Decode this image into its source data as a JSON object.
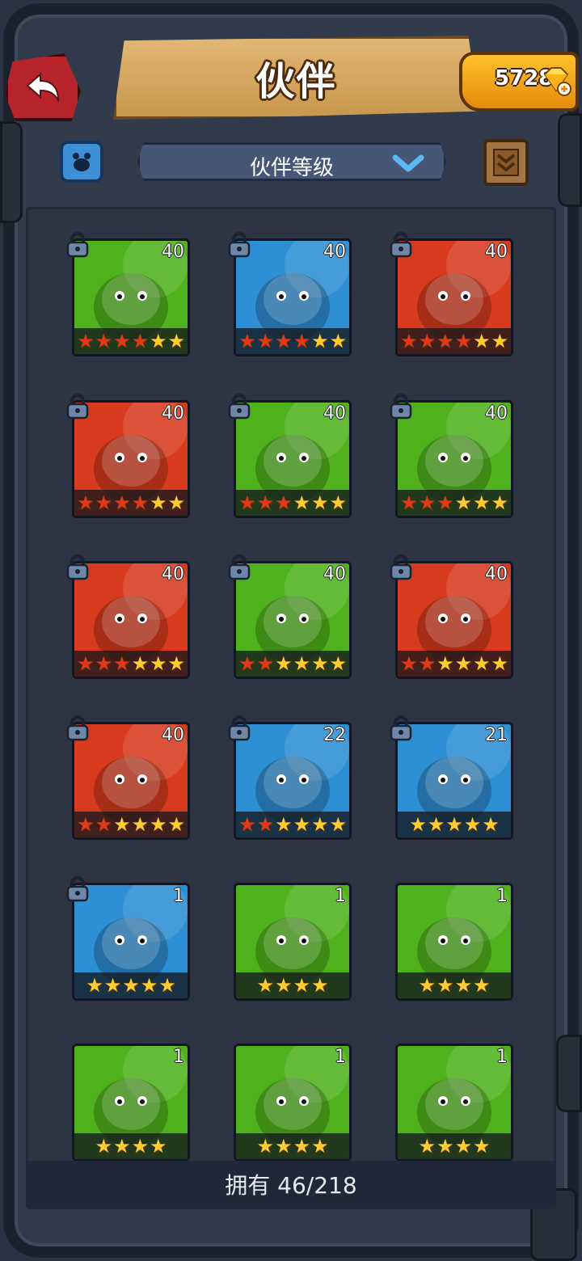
{
  "header": {
    "title": "伙伴",
    "currency_amount": "5728"
  },
  "filter": {
    "sort_label": "伙伴等级"
  },
  "partners": [
    {
      "level": "40",
      "stars": 6,
      "red": 4,
      "theme": "green",
      "locked": true
    },
    {
      "level": "40",
      "stars": 6,
      "red": 4,
      "theme": "blue",
      "locked": true
    },
    {
      "level": "40",
      "stars": 6,
      "red": 4,
      "theme": "red",
      "locked": true
    },
    {
      "level": "40",
      "stars": 6,
      "red": 4,
      "theme": "red",
      "locked": true
    },
    {
      "level": "40",
      "stars": 6,
      "red": 3,
      "theme": "green",
      "locked": true
    },
    {
      "level": "40",
      "stars": 6,
      "red": 3,
      "theme": "green",
      "locked": true
    },
    {
      "level": "40",
      "stars": 6,
      "red": 3,
      "theme": "red",
      "locked": true
    },
    {
      "level": "40",
      "stars": 6,
      "red": 2,
      "theme": "green",
      "locked": true
    },
    {
      "level": "40",
      "stars": 6,
      "red": 2,
      "theme": "red",
      "locked": true
    },
    {
      "level": "40",
      "stars": 6,
      "red": 2,
      "theme": "red",
      "locked": true
    },
    {
      "level": "22",
      "stars": 6,
      "red": 2,
      "theme": "blue",
      "locked": true
    },
    {
      "level": "21",
      "stars": 5,
      "red": 0,
      "theme": "blue",
      "locked": true
    },
    {
      "level": "1",
      "stars": 5,
      "red": 0,
      "theme": "blue",
      "locked": true
    },
    {
      "level": "1",
      "stars": 4,
      "red": 0,
      "theme": "green",
      "locked": false
    },
    {
      "level": "1",
      "stars": 4,
      "red": 0,
      "theme": "green",
      "locked": false
    },
    {
      "level": "1",
      "stars": 4,
      "red": 0,
      "theme": "green",
      "locked": false
    },
    {
      "level": "1",
      "stars": 4,
      "red": 0,
      "theme": "green",
      "locked": false
    },
    {
      "level": "1",
      "stars": 4,
      "red": 0,
      "theme": "green",
      "locked": false
    }
  ],
  "footer": {
    "owned_label": "拥有 46/218"
  },
  "colors": {
    "green": "#4fb21c",
    "blue": "#2d8fd4",
    "red": "#d83a1e",
    "star": "#ffcc33",
    "star_red": "#e03a1a"
  },
  "icons": {
    "back": "back-arrow-icon",
    "currency": "gem-icon",
    "filter": "pet-filter-icon",
    "dropdown": "chevron-down-icon",
    "lock": "lock-icon"
  }
}
